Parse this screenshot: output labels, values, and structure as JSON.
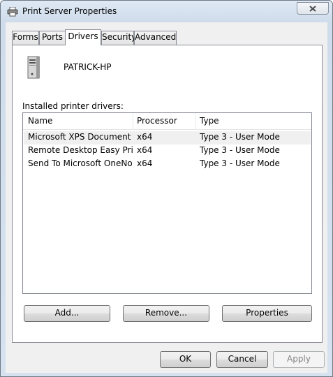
{
  "window": {
    "title": "Print Server Properties"
  },
  "tabs": [
    {
      "label": "Forms"
    },
    {
      "label": "Ports"
    },
    {
      "label": "Drivers"
    },
    {
      "label": "Security"
    },
    {
      "label": "Advanced"
    }
  ],
  "active_tab": "Drivers",
  "server": {
    "name": "PATRICK-HP"
  },
  "drivers": {
    "label": "Installed printer drivers:",
    "columns": [
      "Name",
      "Processor",
      "Type"
    ],
    "rows": [
      {
        "name": "Microsoft XPS Document ...",
        "processor": "x64",
        "type": "Type 3 - User Mode"
      },
      {
        "name": "Remote Desktop Easy Print",
        "processor": "x64",
        "type": "Type 3 - User Mode"
      },
      {
        "name": "Send To Microsoft OneNo...",
        "processor": "x64",
        "type": "Type 3 - User Mode"
      }
    ]
  },
  "buttons": {
    "add": "Add...",
    "remove": "Remove...",
    "properties": "Properties",
    "ok": "OK",
    "cancel": "Cancel",
    "apply": "Apply"
  },
  "icons": {
    "title": "printer-icon",
    "server": "server-tower-icon",
    "close": "close-icon"
  }
}
